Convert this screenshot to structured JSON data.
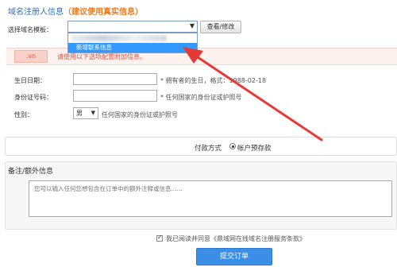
{
  "registrant": {
    "title": "域名注册人信息",
    "title_hint": "（建议使用真实信息）",
    "template_label": "选择域名模板：",
    "view_edit_button": "查看/修改",
    "dropdown": {
      "option_partial": "••••••••••••",
      "new_contact_option": "新增联系信息"
    }
  },
  "notice": {
    "domain_badge": ".vn",
    "text": "请使用以下选项配置附加信息。"
  },
  "form": {
    "birthday": {
      "label": "生日日期：",
      "hint": "* 拥有者的生日，格式：1988-02-18"
    },
    "id_number": {
      "label": "身份证号码：",
      "hint": "* 任何国家的身份证或护照号"
    },
    "gender": {
      "label": "性别：",
      "selected": "男",
      "hint": "任何国家的身份证或护照号"
    }
  },
  "payment": {
    "label": "付款方式",
    "option": "帐户预存款"
  },
  "notes": {
    "title": "备注/额外信息",
    "placeholder": "您可以输入任何您想包含在订单中的额外注释或信息......"
  },
  "agreement": {
    "text": "我已阅读并同意《鼎域网在线域名注册服务条款》"
  },
  "submit_button": "提交订单",
  "colors": {
    "accent_blue": "#3a8ee6",
    "title_blue": "#2b6fb6",
    "hint_orange": "#e67e22",
    "warning_red": "#e74c3c",
    "annotation_red": "#e53935"
  }
}
